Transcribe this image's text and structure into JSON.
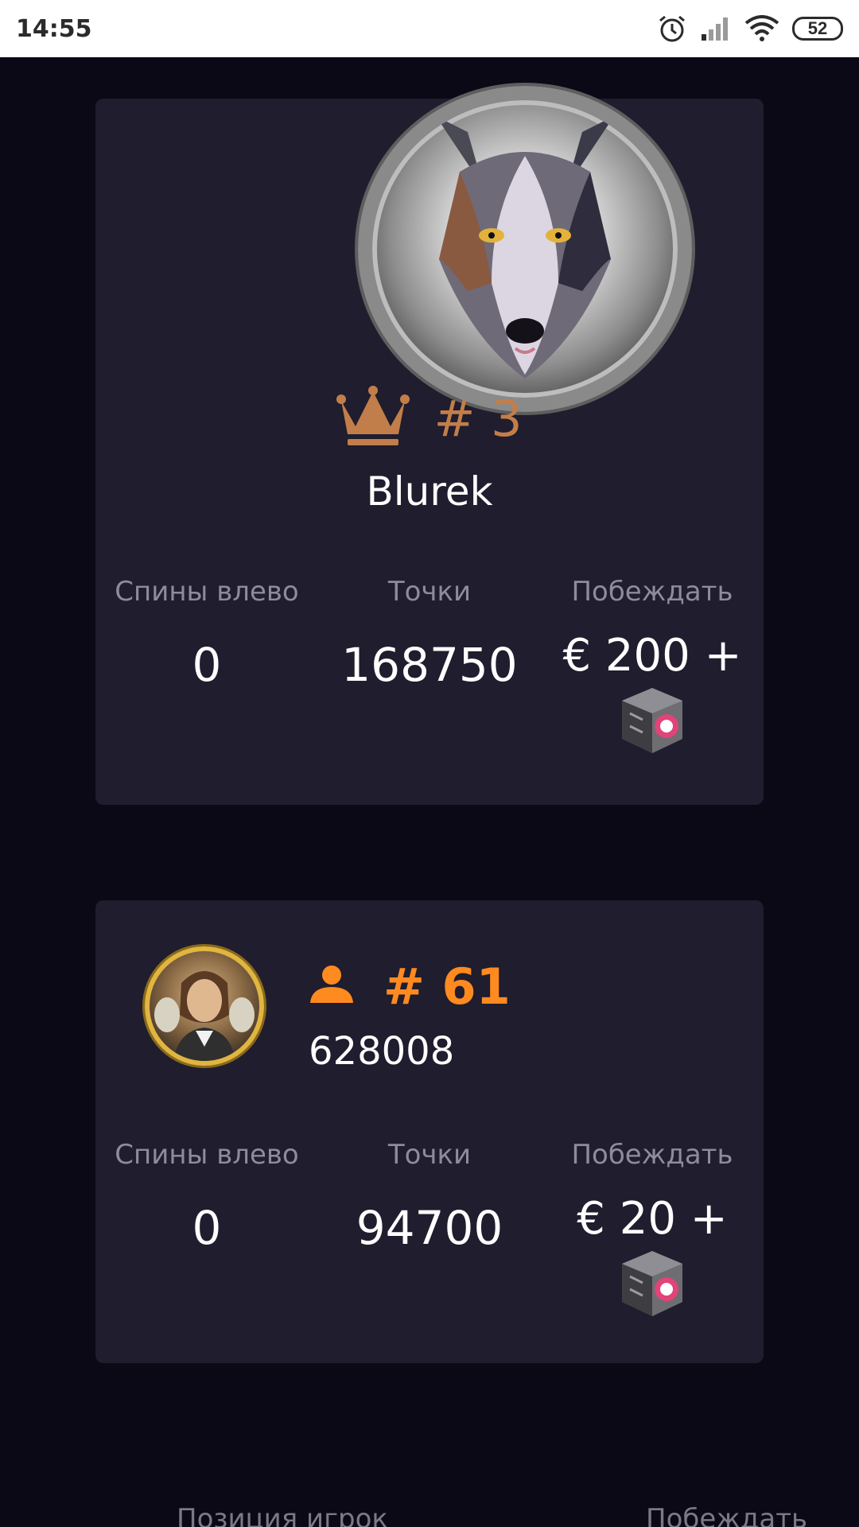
{
  "status_bar": {
    "time": "14:55",
    "battery": "52",
    "icons": [
      "alarm-icon",
      "signal-icon",
      "wifi-icon",
      "battery-icon"
    ]
  },
  "top_card": {
    "avatar": "wolf-avatar",
    "rank_icon": "crown-icon",
    "rank": "# 3",
    "player_name": "Blurek",
    "stats": {
      "spins_label": "Спины влево",
      "spins_value": "0",
      "points_label": "Точки",
      "points_value": "168750",
      "win_label": "Побеждать",
      "win_value": "€ 200 +",
      "win_icon": "mystery-box-icon"
    }
  },
  "bottom_card": {
    "avatar": "user-avatar",
    "rank_icon": "person-icon",
    "rank": "# 61",
    "player_name": "628008",
    "stats": {
      "spins_label": "Спины влево",
      "spins_value": "0",
      "points_label": "Точки",
      "points_value": "94700",
      "win_label": "Побеждать",
      "win_value": "€ 20 +",
      "win_icon": "mystery-box-icon"
    }
  },
  "footer_labels": {
    "left": "Позиция игрок",
    "right": "Побеждать"
  },
  "colors": {
    "background": "#0a0915",
    "card": "#1f1d2e",
    "rank_top": "#c27e4a",
    "rank_bottom": "#ff8a1f",
    "label": "#8e8c9a"
  }
}
